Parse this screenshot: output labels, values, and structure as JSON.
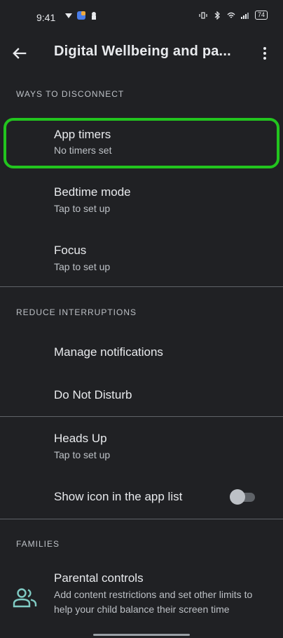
{
  "status_bar": {
    "time": "9:41",
    "battery": "74"
  },
  "app_bar": {
    "title": "Digital Wellbeing and pa...",
    "back_icon": "arrow-back-icon",
    "menu_icon": "more-vert-icon"
  },
  "sections": {
    "disconnect": "WAYS TO DISCONNECT",
    "interruptions": "REDUCE INTERRUPTIONS",
    "families": "FAMILIES"
  },
  "items": {
    "app_timers": {
      "title": "App timers",
      "subtitle": "No timers set"
    },
    "bedtime": {
      "title": "Bedtime mode",
      "subtitle": "Tap to set up"
    },
    "focus": {
      "title": "Focus",
      "subtitle": "Tap to set up"
    },
    "notifications": {
      "title": "Manage notifications"
    },
    "dnd": {
      "title": "Do Not Disturb"
    },
    "heads_up": {
      "title": "Heads Up",
      "subtitle": "Tap to set up"
    },
    "show_icon": {
      "title": "Show icon in the app list",
      "toggle_on": false
    },
    "parental": {
      "title": "Parental controls",
      "subtitle": "Add content restrictions and set other limits to help your child balance their screen time"
    }
  },
  "colors": {
    "highlight": "#22c51e",
    "background": "#202124",
    "accent_icon": "#80cbc4"
  }
}
